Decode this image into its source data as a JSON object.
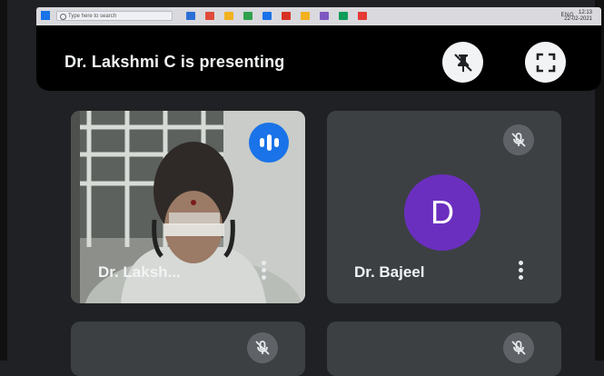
{
  "taskbar": {
    "search_placeholder": "Type here to search",
    "tray_text": "ENG",
    "clock_time": "12:13",
    "clock_date": "22-02-2021",
    "icon_colors": [
      "#2b6fd6",
      "#e04a3a",
      "#f2b11e",
      "#30a14e",
      "#1a73e8",
      "#d93025",
      "#f2b11e",
      "#7e57c2",
      "#0f9d58",
      "#e53935"
    ]
  },
  "banner": {
    "text": "Dr. Lakshmi C is presenting",
    "unpin_icon": "pin-off-icon",
    "fullscreen_icon": "fullscreen-icon"
  },
  "tiles": [
    {
      "name": "Dr. Laksh...",
      "state": "speaking",
      "has_video": true
    },
    {
      "name": "Dr. Bajeel",
      "avatar_letter": "D",
      "avatar_color": "#6b2fbf",
      "state": "muted"
    },
    {
      "name": "",
      "state": "muted"
    },
    {
      "name": "",
      "state": "muted"
    }
  ],
  "colors": {
    "background": "#202124",
    "tile": "#3c4043",
    "speaking": "#1a73e8",
    "muted_badge": "#5f6368"
  }
}
